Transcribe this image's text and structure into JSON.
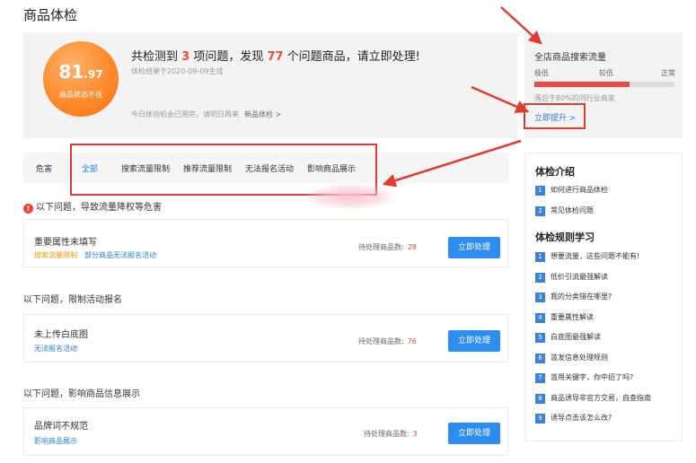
{
  "page": {
    "title": "商品体检"
  },
  "summary": {
    "score_int": "81",
    "score_dec": ".97",
    "score_status": "商品状态不佳",
    "headline": {
      "part1": "共检测到 ",
      "items_count": "3",
      "part2": " 项问题，发现 ",
      "products_count": "77",
      "part3": " 个问题商品，请立即处理!"
    },
    "result_time": "体检结果于2020-09-09生成",
    "today_note": "今日体验机会已用完，请明日再来",
    "today_link": "新品体检 >"
  },
  "traffic": {
    "title": "全店商品搜索流量",
    "levels": [
      "极低",
      "较低",
      "正常"
    ],
    "level_fraction": 0.68,
    "note": "落后于80%的同行业商家",
    "improve_label": "立即提升 >"
  },
  "tabs": {
    "label_danger": "危害",
    "items": [
      "全部",
      "搜索流量限制",
      "推荐流量限制",
      "无法报名活动",
      "影响商品展示"
    ],
    "active_index": 0
  },
  "sections": [
    {
      "title": "以下问题，导致流量降权等危害",
      "has_warning_icon": true,
      "issue": {
        "name": "重要属性未填写",
        "tags": [
          {
            "text": "搜索流量限制",
            "color": "orange"
          },
          {
            "text": "部分商品无法报名活动",
            "color": "blue"
          }
        ],
        "pending_label": "待处理商品数:",
        "pending_count": "28",
        "button_label": "立即处理"
      }
    },
    {
      "title": "以下问题，限制活动报名",
      "has_warning_icon": false,
      "issue": {
        "name": "未上传白底图",
        "tags": [
          {
            "text": "无法报名活动",
            "color": "blue"
          }
        ],
        "pending_label": "待处理商品数:",
        "pending_count": "76",
        "button_label": "立即处理"
      }
    },
    {
      "title": "以下问题，影响商品信息展示",
      "has_warning_icon": false,
      "issue": {
        "name": "品牌词不规范",
        "tags": [
          {
            "text": "影响商品展示",
            "color": "blue"
          }
        ],
        "pending_label": "待处理商品数:",
        "pending_count": "3",
        "button_label": "立即处理"
      }
    }
  ],
  "sidebar": {
    "intro_title": "体检介绍",
    "intro_items": [
      {
        "num": "1",
        "text": "如何进行商品体检"
      },
      {
        "num": "2",
        "text": "常见体检问题"
      }
    ],
    "rules_title": "体检规则学习",
    "rules_items": [
      {
        "num": "1",
        "text": "想要流量，这些问题不能有!"
      },
      {
        "num": "2",
        "text": "低价引流最强解读"
      },
      {
        "num": "3",
        "text": "我的分类错在哪里?"
      },
      {
        "num": "4",
        "text": "重要属性解读"
      },
      {
        "num": "5",
        "text": "白底图最强解读"
      },
      {
        "num": "6",
        "text": "滥发信息处理规则"
      },
      {
        "num": "7",
        "text": "滥用关键字，你中招了吗?"
      },
      {
        "num": "8",
        "text": "商品诱导非官方交易，自查指南"
      },
      {
        "num": "9",
        "text": "诱导点击该怎么改?"
      }
    ]
  },
  "colors": {
    "accent_blue": "#2d8cf0",
    "annotation_red": "#e53a31",
    "count_red": "#e94e3d",
    "tag_orange": "#f39800"
  }
}
